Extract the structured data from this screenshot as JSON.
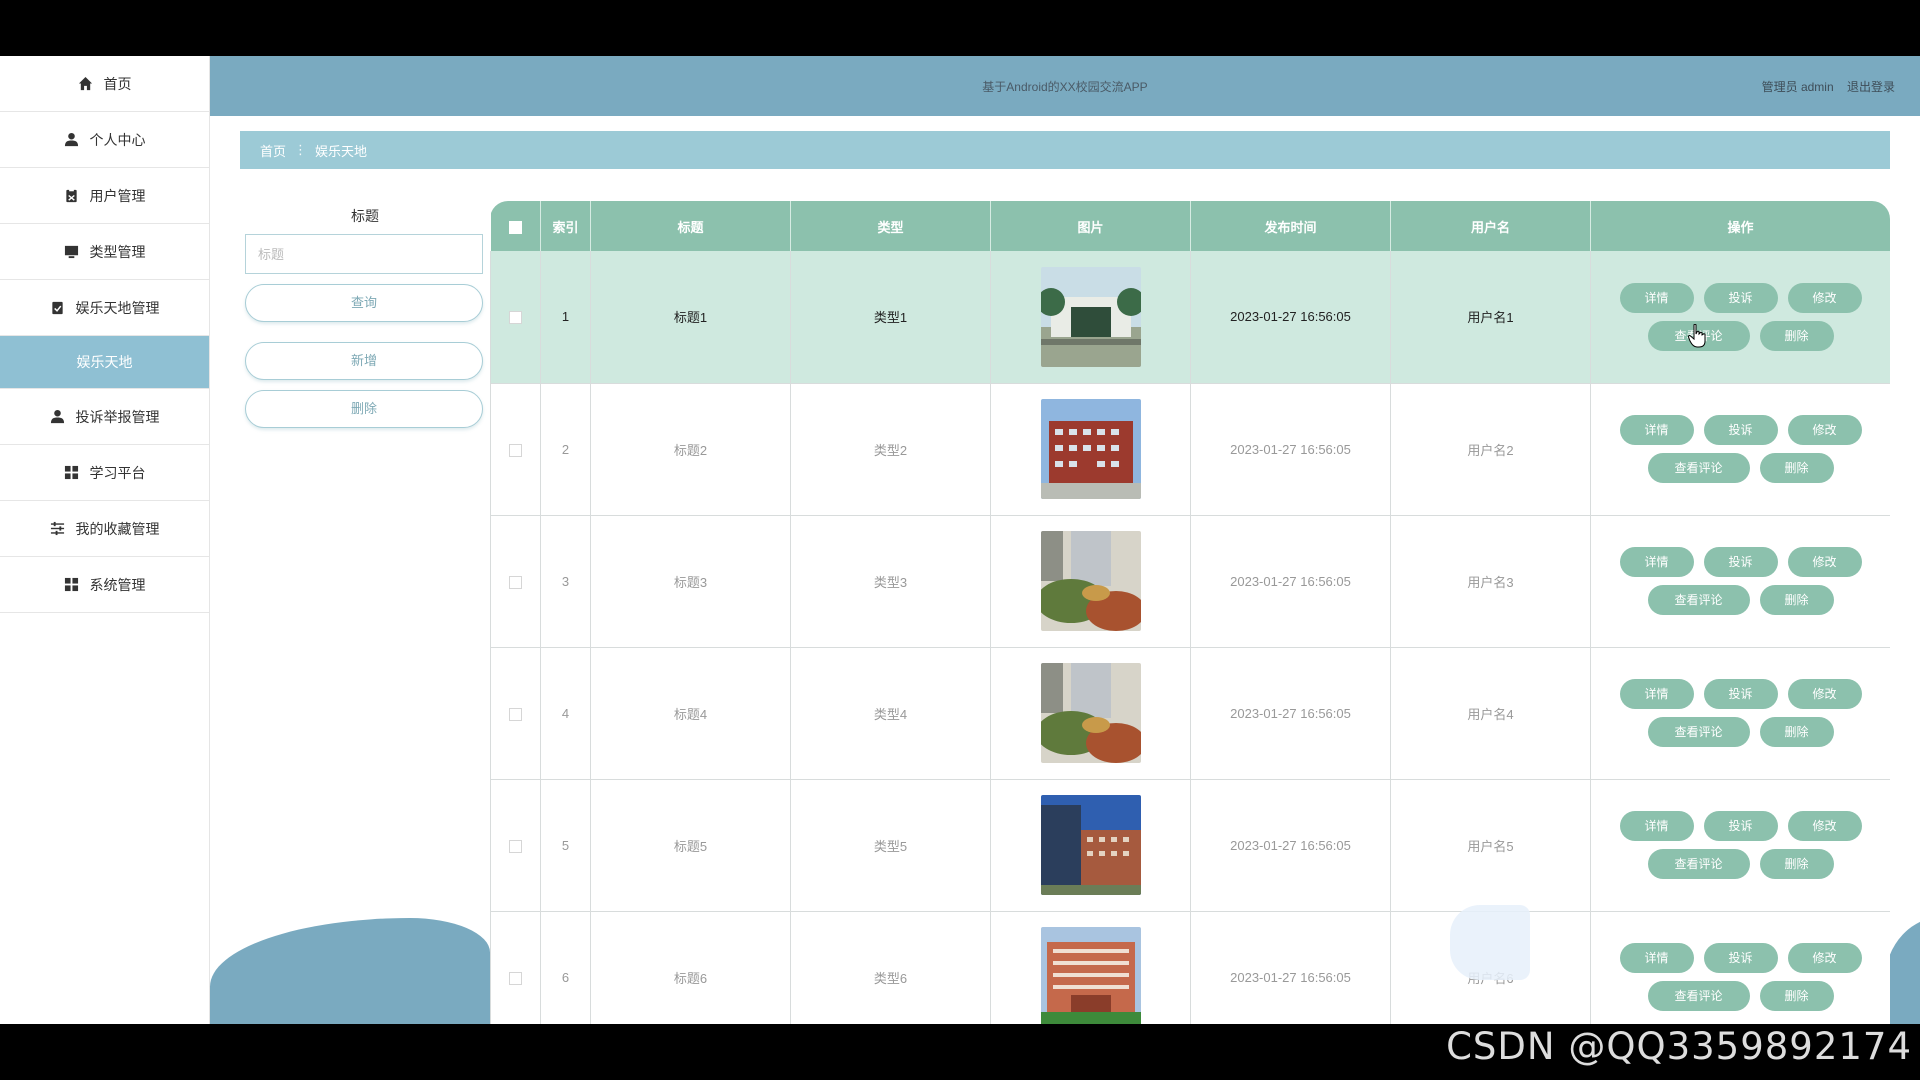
{
  "sidebar": {
    "items": [
      {
        "label": "首页",
        "icon": "home-icon"
      },
      {
        "label": "个人中心",
        "icon": "user-icon"
      },
      {
        "label": "用户管理",
        "icon": "clipboard-icon"
      },
      {
        "label": "类型管理",
        "icon": "monitor-icon"
      },
      {
        "label": "娱乐天地管理",
        "icon": "clipboard-check-icon"
      },
      {
        "label": "娱乐天地",
        "icon": "",
        "active": true
      },
      {
        "label": "投诉举报管理",
        "icon": "user-icon"
      },
      {
        "label": "学习平台",
        "icon": "grid-icon"
      },
      {
        "label": "我的收藏管理",
        "icon": "sliders-icon"
      },
      {
        "label": "系统管理",
        "icon": "grid-icon"
      }
    ]
  },
  "header": {
    "title": "基于Android的XX校园交流APP",
    "user": "管理员 admin",
    "logout": "退出登录"
  },
  "breadcrumb": {
    "home": "首页",
    "separator": "⋮",
    "current": "娱乐天地"
  },
  "search": {
    "label": "标题",
    "placeholder": "标题",
    "value": "",
    "query_btn": "查询",
    "add_btn": "新增",
    "delete_btn": "删除"
  },
  "table": {
    "headers": [
      "索引",
      "标题",
      "类型",
      "图片",
      "发布时间",
      "用户名",
      "操作"
    ],
    "actions": {
      "detail": "详情",
      "complain": "投诉",
      "edit": "修改",
      "comments": "查看评论",
      "delete": "删除"
    },
    "rows": [
      {
        "index": "1",
        "title": "标题1",
        "type": "类型1",
        "time": "2023-01-27 16:56:05",
        "user": "用户名1"
      },
      {
        "index": "2",
        "title": "标题2",
        "type": "类型2",
        "time": "2023-01-27 16:56:05",
        "user": "用户名2"
      },
      {
        "index": "3",
        "title": "标题3",
        "type": "类型3",
        "time": "2023-01-27 16:56:05",
        "user": "用户名3"
      },
      {
        "index": "4",
        "title": "标题4",
        "type": "类型4",
        "time": "2023-01-27 16:56:05",
        "user": "用户名4"
      },
      {
        "index": "5",
        "title": "标题5",
        "type": "类型5",
        "time": "2023-01-27 16:56:05",
        "user": "用户名5"
      },
      {
        "index": "6",
        "title": "标题6",
        "type": "类型6",
        "time": "2023-01-27 16:56:05",
        "user": "用户名6"
      }
    ]
  },
  "watermark": {
    "csdn": "CSDN @QQ3359892174"
  },
  "colors": {
    "header": "#7aaac0",
    "breadcrumb": "#9ccad6",
    "table_header": "#8cc1ad",
    "active_side": "#8fc0d3",
    "highlight_row": "#cfe9df"
  }
}
